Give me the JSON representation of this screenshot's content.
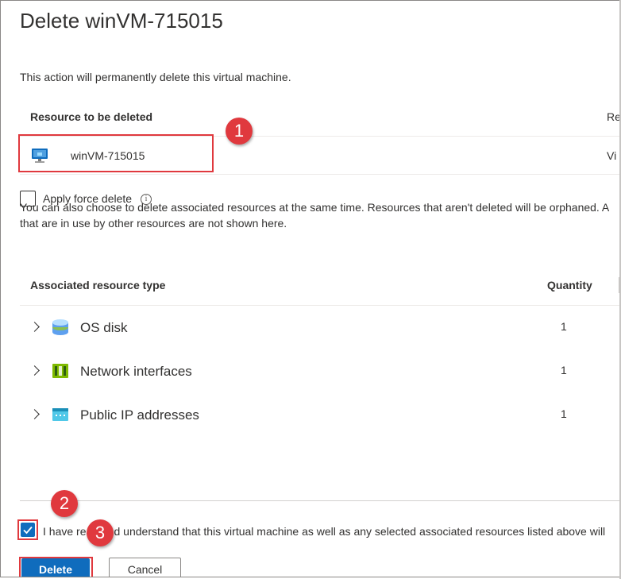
{
  "dialog": {
    "title": "Delete winVM-715015",
    "description": "This action will permanently delete this virtual machine."
  },
  "resource_table": {
    "header_resource": "Resource to be deleted",
    "header_type_truncated": "Re",
    "rows": [
      {
        "name": "winVM-715015",
        "type_truncated": "Vi",
        "icon": "virtual-machine-icon"
      }
    ]
  },
  "force_delete": {
    "label": "Apply force delete",
    "checked": false
  },
  "associated_note": {
    "line1": "You can also choose to delete associated resources at the same time. Resources that aren't deleted will be orphaned. A",
    "line2": "that are in use by other resources are not shown here."
  },
  "associated_table": {
    "header_type": "Associated resource type",
    "header_quantity": "Quantity",
    "rows": [
      {
        "label": "OS disk",
        "quantity": "1",
        "icon": "disk-icon"
      },
      {
        "label": "Network interfaces",
        "quantity": "1",
        "icon": "network-interface-icon"
      },
      {
        "label": "Public IP addresses",
        "quantity": "1",
        "icon": "public-ip-icon"
      }
    ]
  },
  "confirm": {
    "text": "I have read and understand that this virtual machine as well as any selected associated resources listed above will",
    "checked": true
  },
  "buttons": {
    "delete": "Delete",
    "cancel": "Cancel"
  },
  "callouts": [
    "1",
    "2",
    "3"
  ],
  "colors": {
    "accent": "#0f6cbd",
    "callout": "#e0393e"
  }
}
